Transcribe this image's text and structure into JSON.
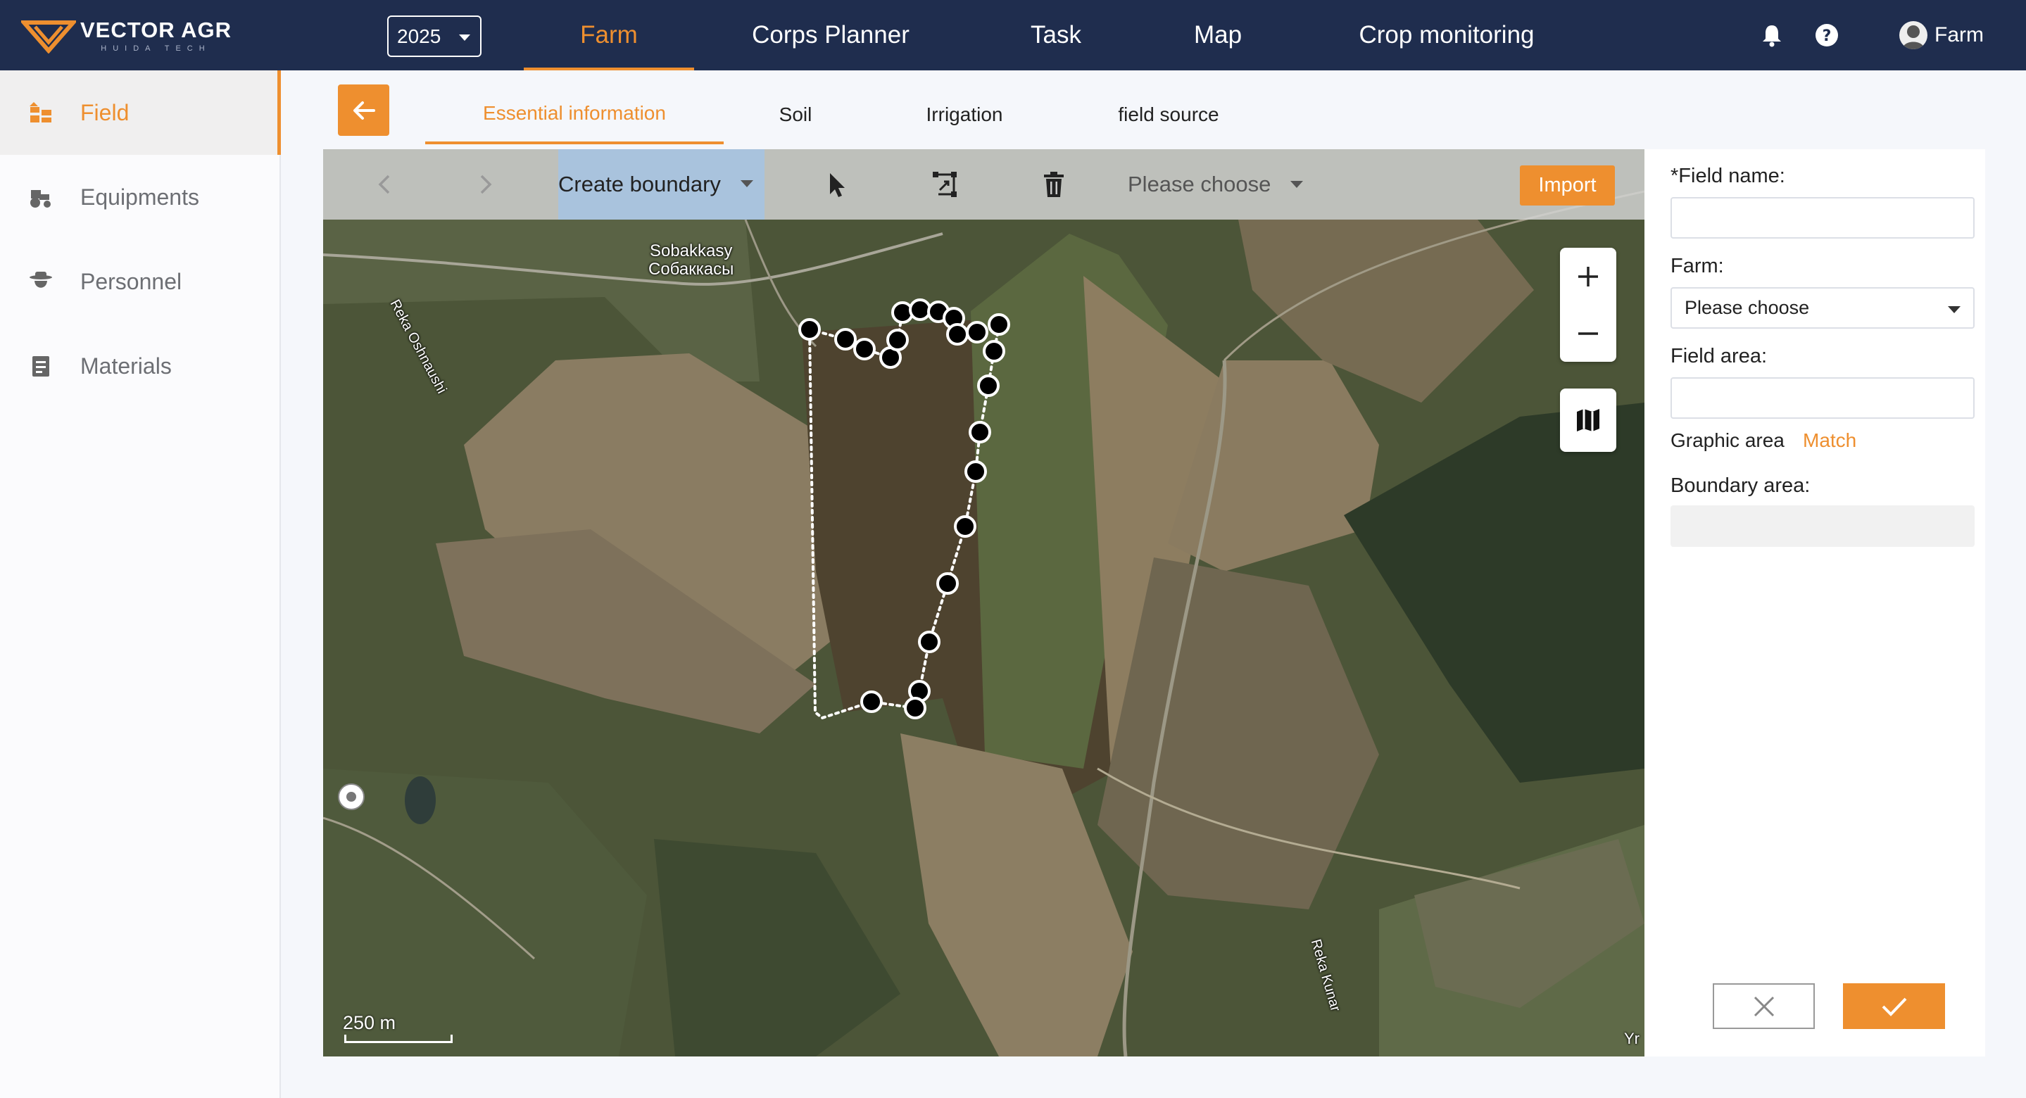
{
  "app": {
    "logo_name": "VECTOR AGR",
    "logo_sub": "HUIDA TECH",
    "year": "2025",
    "brand_color": "#ee8f2f",
    "nav_bg": "#1f2d4e"
  },
  "nav": {
    "farm": "Farm",
    "corps_planner": "Corps Planner",
    "task": "Task",
    "map": "Map",
    "crop_monitoring": "Crop monitoring"
  },
  "user": {
    "name": "Farm"
  },
  "sidebar": {
    "items": [
      {
        "label": "Field",
        "icon": "field-icon",
        "active": true
      },
      {
        "label": "Equipments",
        "icon": "tractor-icon",
        "active": false
      },
      {
        "label": "Personnel",
        "icon": "person-hat-icon",
        "active": false
      },
      {
        "label": "Materials",
        "icon": "clipboard-icon",
        "active": false
      }
    ]
  },
  "tabs": {
    "essential": "Essential information",
    "soil": "Soil",
    "irrigation": "Irrigation",
    "field_source": "field source"
  },
  "map_toolbar": {
    "create_boundary": "Create boundary",
    "please_choose": "Please choose",
    "import": "Import"
  },
  "map_labels": {
    "village_latin": "Sobakkasy",
    "village_cyrillic": "Собаккасы",
    "river1": "Reka Oshnaushi",
    "river2": "Reka Kunar",
    "edge1": "Yr",
    "scale": "250 m"
  },
  "form": {
    "field_name_label": "*Field name:",
    "farm_label": "Farm:",
    "farm_placeholder": "Please choose",
    "field_area_label": "Field area:",
    "graphic_area_label": "Graphic area",
    "match_label": "Match",
    "boundary_area_label": "Boundary area:"
  }
}
